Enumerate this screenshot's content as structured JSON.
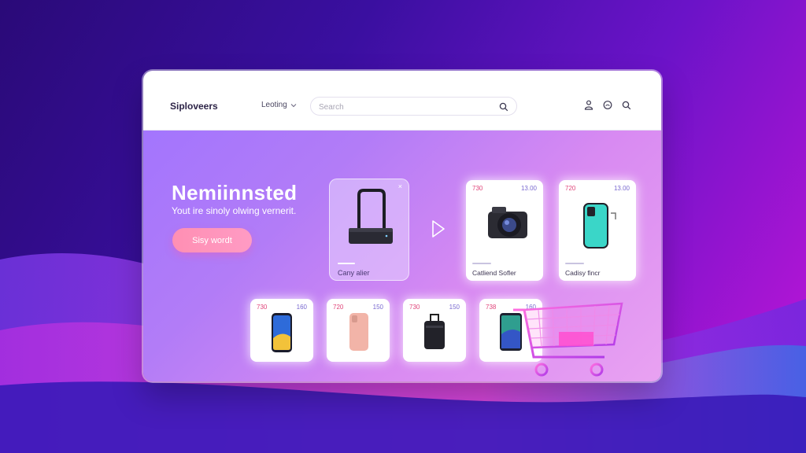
{
  "header": {
    "brand": "Siploveers",
    "menu_label": "Leoting",
    "search_placeholder": "Search"
  },
  "icons": {
    "menu_chevron": "chevron-down-icon",
    "search": "search-icon",
    "account": "user-icon",
    "notifications": "bell-icon",
    "top_search": "search-icon",
    "featured_close": "close-icon",
    "play": "play-icon",
    "cart": "shopping-cart-icon"
  },
  "hero": {
    "headline": "Nemiinnsted",
    "subline": "Yout ire sinoly olwing vernerit.",
    "cta_label": "Sisy wordt"
  },
  "featured": {
    "label": "Cany alier",
    "close": "×"
  },
  "cards_top": [
    {
      "price_left": "730",
      "price_right": "13.00",
      "label": "Catliend Sofler"
    },
    {
      "price_left": "720",
      "price_right": "13.00",
      "label": "Cadisy fincr"
    }
  ],
  "cards_bottom": [
    {
      "price_left": "730",
      "price_right": "160"
    },
    {
      "price_left": "720",
      "price_right": "150"
    },
    {
      "price_left": "730",
      "price_right": "150"
    },
    {
      "price_left": "738",
      "price_right": "160"
    }
  ],
  "colors": {
    "background_start": "#2a0a78",
    "background_end": "#c316d8",
    "window_gradient_start": "#9f73ff",
    "window_gradient_end": "#e9a2f2",
    "cta": "#ff8fb3",
    "price_accent": "#e0457a",
    "cart": "#ea4fd6"
  }
}
